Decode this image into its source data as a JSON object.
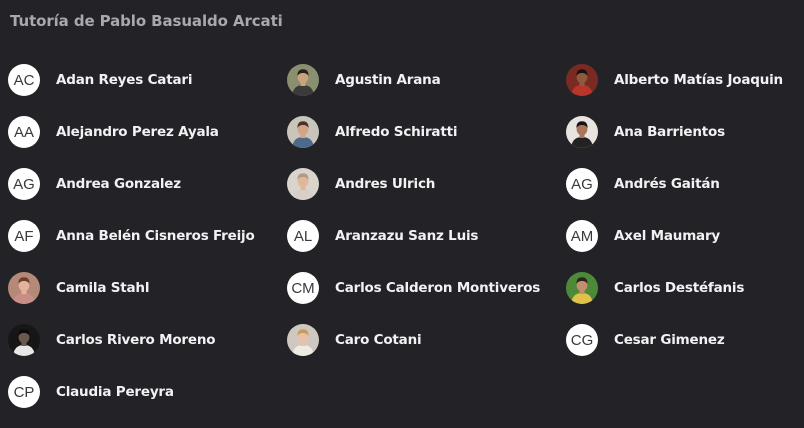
{
  "page": {
    "title": "Tutoría de Pablo Basualdo Arcati"
  },
  "people": [
    {
      "name": "Adan Reyes Catari",
      "avatar": {
        "type": "initials",
        "text": "AC"
      }
    },
    {
      "name": "Agustin Arana",
      "avatar": {
        "type": "photo",
        "icon": "user-photo-icon",
        "bg": "#8a8f70",
        "skin": "#c9a27e",
        "hair": "#2b2119",
        "shirt": "#3b3b3b"
      }
    },
    {
      "name": "Alberto Matías Joaquin",
      "avatar": {
        "type": "photo",
        "icon": "user-photo-icon",
        "bg": "#7a2a22",
        "skin": "#8d5a3d",
        "hair": "#1a1210",
        "shirt": "#b8352a"
      }
    },
    {
      "name": "Alejandro Perez Ayala",
      "avatar": {
        "type": "initials",
        "text": "AA"
      }
    },
    {
      "name": "Alfredo Schiratti",
      "avatar": {
        "type": "photo",
        "icon": "user-photo-icon",
        "bg": "#c9c5bd",
        "skin": "#d2a584",
        "hair": "#4a3325",
        "shirt": "#4d6a8c"
      }
    },
    {
      "name": "Ana Barrientos",
      "avatar": {
        "type": "photo",
        "icon": "user-photo-icon",
        "bg": "#e8e4e0",
        "skin": "#a9765a",
        "hair": "#181414",
        "shirt": "#222222"
      }
    },
    {
      "name": "Andrea Gonzalez",
      "avatar": {
        "type": "initials",
        "text": "AG"
      }
    },
    {
      "name": "Andres Ulrich",
      "avatar": {
        "type": "photo",
        "icon": "user-photo-icon",
        "bg": "#d9d4cc",
        "skin": "#e0b79b",
        "hair": "#b59a82",
        "shirt": "#d8d0c8"
      }
    },
    {
      "name": "Andrés Gaitán",
      "avatar": {
        "type": "initials",
        "text": "AG"
      }
    },
    {
      "name": "Anna Belén Cisneros Freijo",
      "avatar": {
        "type": "initials",
        "text": "AF"
      }
    },
    {
      "name": "Aranzazu Sanz Luis",
      "avatar": {
        "type": "initials",
        "text": "AL"
      }
    },
    {
      "name": "Axel Maumary",
      "avatar": {
        "type": "initials",
        "text": "AM"
      }
    },
    {
      "name": "Camila Stahl",
      "avatar": {
        "type": "photo",
        "icon": "user-photo-icon",
        "bg": "#b58978",
        "skin": "#e3b39c",
        "hair": "#6b3f2c",
        "shirt": "#c98f86"
      }
    },
    {
      "name": "Carlos Calderon Montiveros",
      "avatar": {
        "type": "initials",
        "text": "CM"
      }
    },
    {
      "name": "Carlos Destéfanis",
      "avatar": {
        "type": "photo",
        "icon": "user-photo-icon",
        "bg": "#4c8a3a",
        "skin": "#c29070",
        "hair": "#2d241c",
        "shirt": "#e0c14a"
      }
    },
    {
      "name": "Carlos Rivero Moreno",
      "avatar": {
        "type": "photo",
        "icon": "user-photo-icon",
        "bg": "#161616",
        "skin": "#6a5a4e",
        "hair": "#0c0c0c",
        "shirt": "#e8e8e8"
      }
    },
    {
      "name": "Caro Cotani",
      "avatar": {
        "type": "photo",
        "icon": "user-photo-icon",
        "bg": "#cfc8c0",
        "skin": "#e6c3a8",
        "hair": "#c89a5c",
        "shirt": "#f0eae4"
      }
    },
    {
      "name": "Cesar Gimenez",
      "avatar": {
        "type": "initials",
        "text": "CG"
      }
    },
    {
      "name": "Claudia Pereyra",
      "avatar": {
        "type": "initials",
        "text": "CP"
      }
    }
  ]
}
